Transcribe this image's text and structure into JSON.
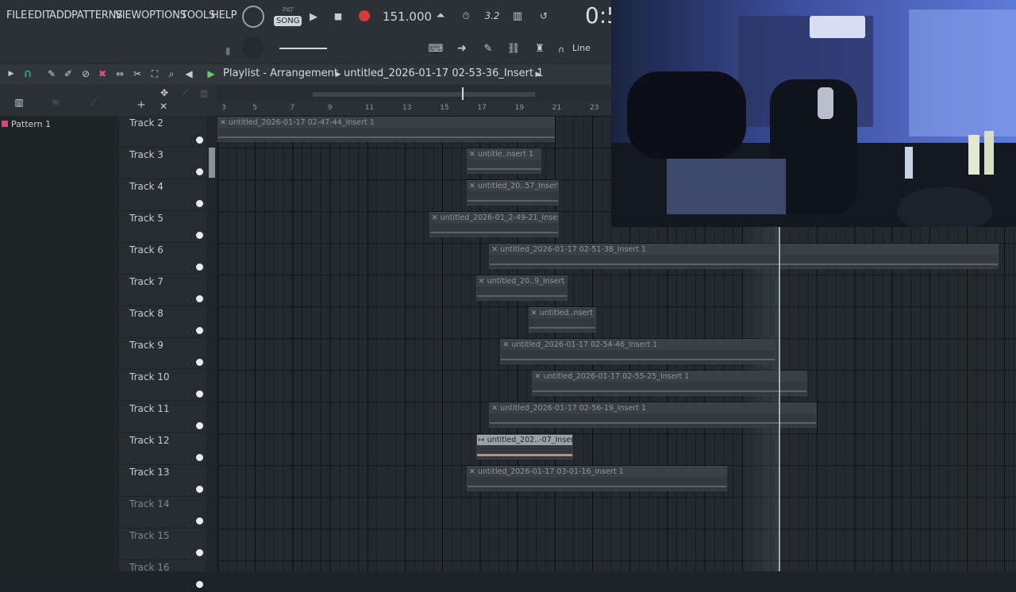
{
  "menu": [
    "FILE",
    "EDIT",
    "ADD",
    "PATTERNS",
    "VIEW",
    "OPTIONS",
    "TOOLS",
    "HELP"
  ],
  "transport": {
    "pat_label": "PAT",
    "song_label": "SONG",
    "tempo": "151.000",
    "time_display": "0:5",
    "snap_mode": "Line"
  },
  "playlist": {
    "title": "Playlist - Arrangement",
    "clip_name": "untitled_2026-01-17 02-53-36_Insert 1",
    "pattern": "Pattern 1"
  },
  "ruler": [
    "3",
    "5",
    "7",
    "9",
    "11",
    "13",
    "15",
    "17",
    "19",
    "21",
    "23"
  ],
  "tracks": [
    {
      "name": "Track 2",
      "dim": false
    },
    {
      "name": "Track 3",
      "dim": false
    },
    {
      "name": "Track 4",
      "dim": false
    },
    {
      "name": "Track 5",
      "dim": false
    },
    {
      "name": "Track 6",
      "dim": false
    },
    {
      "name": "Track 7",
      "dim": false
    },
    {
      "name": "Track 8",
      "dim": false
    },
    {
      "name": "Track 9",
      "dim": false
    },
    {
      "name": "Track 10",
      "dim": false
    },
    {
      "name": "Track 11",
      "dim": false
    },
    {
      "name": "Track 12",
      "dim": false
    },
    {
      "name": "Track 13",
      "dim": false
    },
    {
      "name": "Track 14",
      "dim": true
    },
    {
      "name": "Track 15",
      "dim": true
    },
    {
      "name": "Track 16",
      "dim": true
    }
  ],
  "clips": [
    {
      "track": 0,
      "label": "untitled_2026-01-17 02-47-44_Insert 1",
      "start": 3.0,
      "end": 21.0
    },
    {
      "track": 1,
      "label": "untitle..nsert 1",
      "start": 16.3,
      "end": 20.3
    },
    {
      "track": 2,
      "label": "untitled_20..57_Insert 1",
      "start": 16.3,
      "end": 21.2
    },
    {
      "track": 3,
      "label": "untitled_2026-01_2-49-21_Insert 1",
      "start": 14.3,
      "end": 21.2
    },
    {
      "track": 4,
      "label": "untitled_2026-01-17 02-51-38_Insert 1",
      "start": 17.5,
      "end": 45.0
    },
    {
      "track": 5,
      "label": "untitled_20..9_Insert 1",
      "start": 16.8,
      "end": 21.7
    },
    {
      "track": 6,
      "label": "untitled..nsert 1",
      "start": 19.6,
      "end": 23.2
    },
    {
      "track": 7,
      "label": "untitled_2026-01-17 02-54-46_Insert 1",
      "start": 18.1,
      "end": 32.8
    },
    {
      "track": 8,
      "label": "untitled_2026-01-17 02-55-25_Insert 1",
      "start": 19.8,
      "end": 34.5
    },
    {
      "track": 9,
      "label": "untitled_2026-01-17 02-56-19_Insert 1",
      "start": 17.5,
      "end": 35.0
    },
    {
      "track": 10,
      "label": "untitled_202..-07_Insert 1",
      "start": 16.8,
      "end": 22.0,
      "highlight": true
    },
    {
      "track": 11,
      "label": "untitled_2026-01-17 03-01-16_Insert 1",
      "start": 16.3,
      "end": 30.2
    }
  ]
}
